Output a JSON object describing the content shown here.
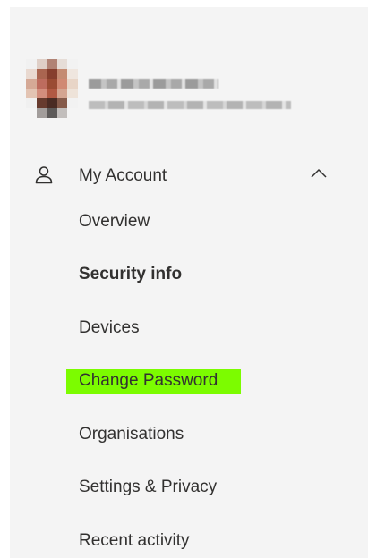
{
  "profile": {
    "name": "",
    "email": "",
    "avatar_colors": [
      "#c98a6e",
      "#a1492f",
      "#6b3a2c",
      "#d8a48e",
      "#efe3d8"
    ]
  },
  "nav": {
    "section_label": "My Account",
    "section_icon": "person-icon",
    "collapse_icon": "chevron-up-icon",
    "items": [
      {
        "label": "Overview",
        "active": false,
        "highlighted": false
      },
      {
        "label": "Security info",
        "active": true,
        "highlighted": false
      },
      {
        "label": "Devices",
        "active": false,
        "highlighted": false
      },
      {
        "label": "Change Password",
        "active": false,
        "highlighted": true
      },
      {
        "label": "Organisations",
        "active": false,
        "highlighted": false
      },
      {
        "label": "Settings & Privacy",
        "active": false,
        "highlighted": false
      },
      {
        "label": "Recent activity",
        "active": false,
        "highlighted": false
      }
    ],
    "highlight_color": "#7cfc00"
  }
}
